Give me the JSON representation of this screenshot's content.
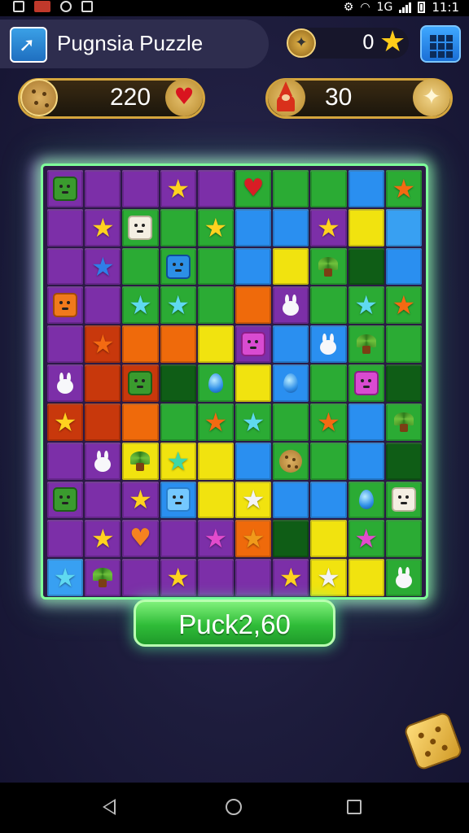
{
  "status_bar": {
    "time": "11:1",
    "network": "1G",
    "icons": [
      "photo-icon",
      "app-badge-icon",
      "gesture-icon",
      "android-icon",
      "gear-icon",
      "wifi-icon",
      "signal-icon",
      "battery-icon"
    ]
  },
  "header": {
    "title": "Pugnsia Puzzle",
    "app_icon": "kangaroo-icon",
    "score": "0",
    "score_icon": "star-icon",
    "compass_icon": "compass-icon",
    "menu_icon": "grid-menu-icon"
  },
  "resources": {
    "cookies": {
      "value": "220",
      "icon": "cookie-icon",
      "side_icon": "heart-icon"
    },
    "moves": {
      "value": "30",
      "icon": "wizard-icon",
      "side_icon": "sparkle-icon"
    }
  },
  "board": {
    "columns": 10,
    "rows": [
      [
        "P:block-green",
        "P",
        "P",
        "P:star-gold",
        "P",
        "G:heart-red",
        "G",
        "G",
        "B",
        "G:star-orange"
      ],
      [
        "P",
        "P:star-gold",
        "G:block-cream",
        "G",
        "G:star-gold",
        "B",
        "B",
        "P:star-gold",
        "Y",
        "L"
      ],
      [
        "P",
        "P:star-blue",
        "G",
        "G:block-blue",
        "G",
        "B",
        "Y",
        "G:plant",
        "D",
        "B"
      ],
      [
        "P:block-orange",
        "P",
        "G:star-cyan",
        "G:star-cyan",
        "G",
        "O",
        "P:bunny",
        "G",
        "G:star-cyan",
        "G:star-orange"
      ],
      [
        "P",
        "R:star-orange",
        "O",
        "O",
        "Y",
        "P:block-magenta",
        "B",
        "B:bunny",
        "G:plant",
        "G"
      ],
      [
        "P:bunny",
        "R",
        "R:block-green",
        "D",
        "G:drop",
        "Y",
        "B:drop",
        "G",
        "G:block-magenta",
        "D"
      ],
      [
        "R:star-gold",
        "R",
        "O",
        "G",
        "G:star-orange",
        "G:star-cyan",
        "G",
        "G:star-orange",
        "B",
        "G:plant"
      ],
      [
        "P",
        "P:bunny",
        "Y:plant",
        "Y:star-teal",
        "Y",
        "B",
        "G:cookie",
        "G",
        "B",
        "D"
      ],
      [
        "P:block-green",
        "P",
        "P:star-gold",
        "B:block-ice",
        "Y",
        "Y:star-white",
        "B",
        "B",
        "G:drop",
        "G:block-cream"
      ],
      [
        "P",
        "P:star-gold",
        "P:heart-orange",
        "P",
        "P:star-pink",
        "O:star-amber",
        "D",
        "Y",
        "G:star-pink",
        "G"
      ],
      [
        "L:star-cyan",
        "P:plant",
        "P",
        "P:star-gold",
        "P",
        "P",
        "P:star-gold",
        "Y:star-white",
        "Y",
        "G:bunny"
      ]
    ]
  },
  "action_button": {
    "label": "Puck2,60"
  },
  "dice_icon": "dice-icon",
  "nav": {
    "back": "back-icon",
    "home": "home-icon",
    "recent": "recent-apps-icon"
  },
  "colors": {
    "board_glow": "#7fff9a",
    "button_green": "#2fbc38",
    "star_gold": "#ffd21f",
    "menu_blue": "#2a8ff0"
  }
}
